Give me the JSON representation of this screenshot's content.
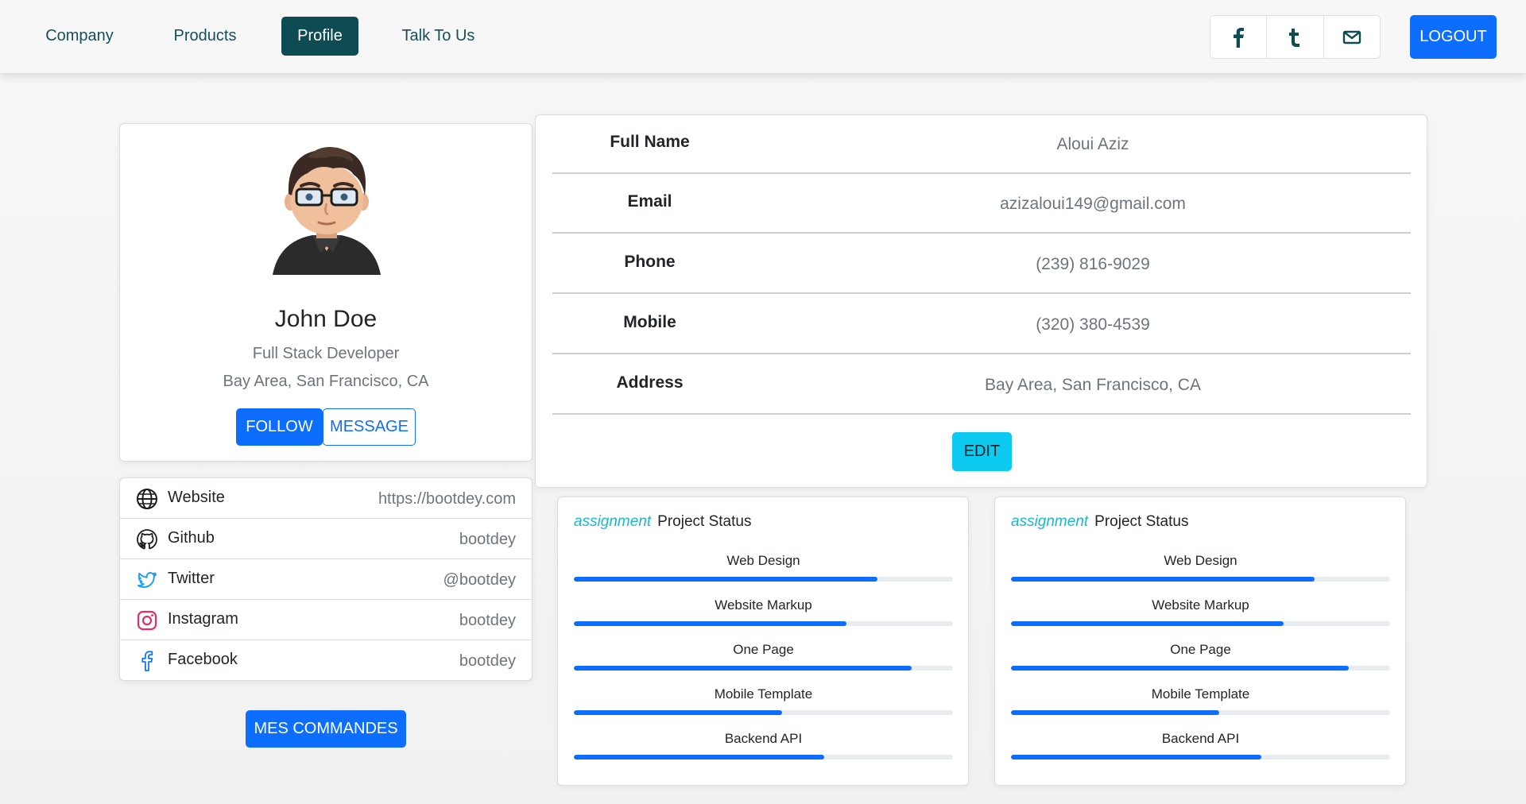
{
  "nav": {
    "links": [
      "Company",
      "Products",
      "Profile",
      "Talk To Us"
    ],
    "active": "Profile",
    "logout_label": "LOGOUT",
    "social_icons": [
      "facebook-icon",
      "tumblr-icon",
      "mail-icon"
    ]
  },
  "profile": {
    "name": "John Doe",
    "role": "Full Stack Developer",
    "location": "Bay Area, San Francisco, CA",
    "follow_label": "FOLLOW",
    "message_label": "MESSAGE"
  },
  "links": [
    {
      "label": "Website",
      "value": "https://bootdey.com",
      "icon": "globe-icon"
    },
    {
      "label": "Github",
      "value": "bootdey",
      "icon": "github-icon"
    },
    {
      "label": "Twitter",
      "value": "@bootdey",
      "icon": "twitter-icon"
    },
    {
      "label": "Instagram",
      "value": "bootdey",
      "icon": "instagram-icon"
    },
    {
      "label": "Facebook",
      "value": "bootdey",
      "icon": "facebook-icon"
    }
  ],
  "commandes_label": "MES COMMANDES",
  "info": {
    "rows": [
      {
        "label": "Full Name",
        "value": "Aloui Aziz"
      },
      {
        "label": "Email",
        "value": "azizaloui149@gmail.com"
      },
      {
        "label": "Phone",
        "value": "(239) 816-9029"
      },
      {
        "label": "Mobile",
        "value": "(320) 380-4539"
      },
      {
        "label": "Address",
        "value": "Bay Area, San Francisco, CA"
      }
    ],
    "edit_label": "EDIT"
  },
  "projects": [
    {
      "accent": "assignment",
      "title": "Project Status",
      "items": [
        {
          "name": "Web Design",
          "progress": 0.8
        },
        {
          "name": "Website Markup",
          "progress": 0.72
        },
        {
          "name": "One Page",
          "progress": 0.89
        },
        {
          "name": "Mobile Template",
          "progress": 0.55
        },
        {
          "name": "Backend API",
          "progress": 0.66
        }
      ]
    },
    {
      "accent": "assignment",
      "title": "Project Status",
      "items": [
        {
          "name": "Web Design",
          "progress": 0.8
        },
        {
          "name": "Website Markup",
          "progress": 0.72
        },
        {
          "name": "One Page",
          "progress": 0.89
        },
        {
          "name": "Mobile Template",
          "progress": 0.55
        },
        {
          "name": "Backend API",
          "progress": 0.66
        }
      ]
    }
  ],
  "colors": {
    "primary": "#0d6efd",
    "nav_active": "#0d4c53",
    "nav_text": "#174f57",
    "info": "#0dcaf0",
    "accent": "#16b8d6"
  }
}
